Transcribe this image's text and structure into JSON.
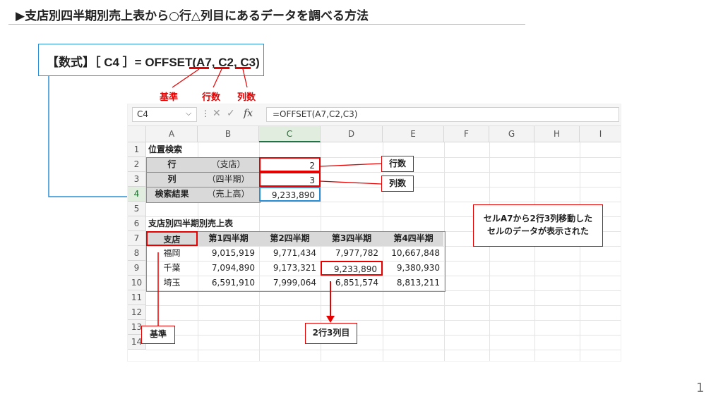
{
  "slide": {
    "title": "▶支店別四半期別売上表から○行△列目にあるデータを調べる方法",
    "page_number": "1"
  },
  "formula_box": {
    "text": "【数式】［ C4 ］= OFFSET(A7, C2, C3)",
    "labels": [
      "基準",
      "行数",
      "列数"
    ]
  },
  "sheet": {
    "name_box": "C4",
    "formula": "=OFFSET(A7,C2,C3)",
    "columns": [
      "A",
      "B",
      "C",
      "D",
      "E",
      "F",
      "G",
      "H",
      "I"
    ],
    "rows": [
      "1",
      "2",
      "3",
      "4",
      "5",
      "6",
      "7",
      "8",
      "9",
      "10",
      "11",
      "12",
      "13",
      "14"
    ],
    "search": {
      "title": "位置検索",
      "row_label": "行",
      "row_note": "（支店）",
      "row_value": "2",
      "col_label": "列",
      "col_note": "（四半期）",
      "col_value": "3",
      "result_label": "検索結果",
      "result_note": "（売上高）",
      "result_value": "9,233,890"
    },
    "table": {
      "title": "支店別四半期別売上表",
      "headers": [
        "支店",
        "第1四半期",
        "第2四半期",
        "第3四半期",
        "第4四半期"
      ],
      "rows": [
        [
          "福岡",
          "9,015,919",
          "9,771,434",
          "7,977,782",
          "10,667,848"
        ],
        [
          "千葉",
          "7,094,890",
          "9,173,321",
          "9,233,890",
          "9,380,930"
        ],
        [
          "埼玉",
          "6,591,910",
          "7,999,064",
          "6,851,574",
          "8,813,211"
        ]
      ]
    }
  },
  "callouts": {
    "row_count": "行数",
    "col_count": "列数",
    "base": "基準",
    "moved": "2行3列目",
    "note_line1": "セルA7から2行3列移動した",
    "note_line2": "セルのデータが表示された"
  }
}
